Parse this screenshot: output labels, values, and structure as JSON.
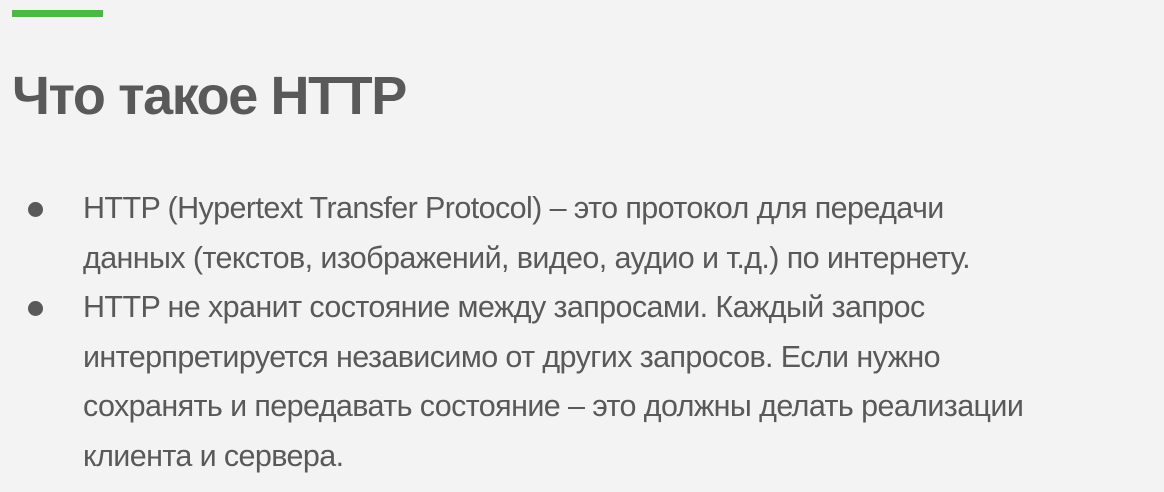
{
  "slide": {
    "accent_color": "#4db848",
    "title": "Что такое HTTP",
    "bullets": [
      {
        "line1": "HTTP (Hypertext Transfer Protocol) – это протокол для передачи",
        "line2": "данных (текстов, изображений, видео, аудио и т.д.) по интернету."
      },
      {
        "line1": "HTTP не хранит состояние между запросами. Каждый запрос",
        "line2": "интерпретируется независимо от других запросов. Если нужно",
        "line3": "сохранять и передавать состояние – это должны делать реализации",
        "line4": "клиента и сервера."
      }
    ]
  }
}
